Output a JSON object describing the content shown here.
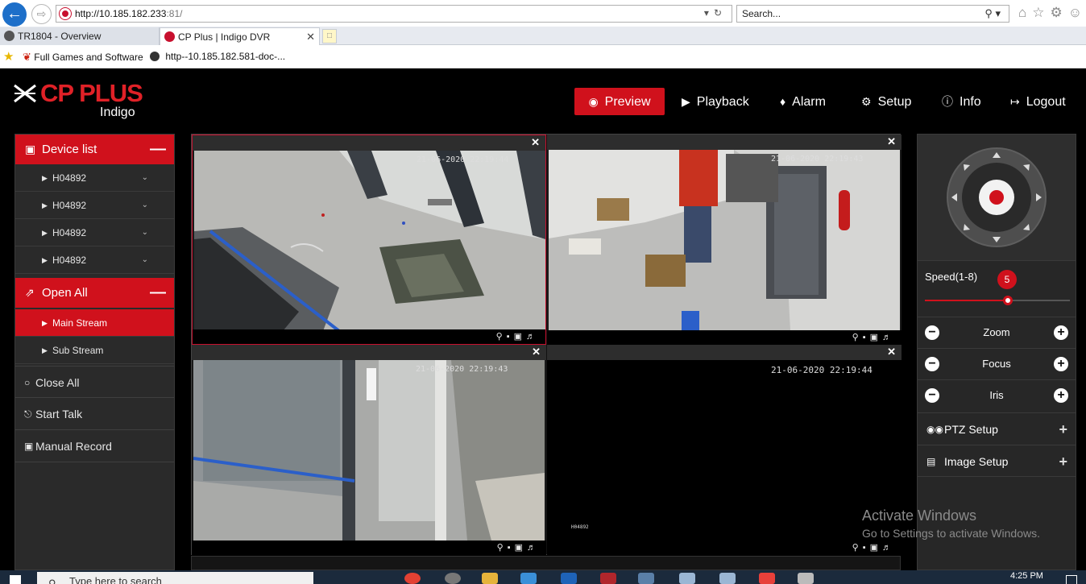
{
  "browser": {
    "url_host": "http://10.185.182.233",
    "url_port": ":81/",
    "search_placeholder": "Search...",
    "tabs": [
      {
        "label": "TR1804 - Overview"
      },
      {
        "label": "CP Plus | Indigo DVR"
      }
    ],
    "favorites": [
      {
        "label": "Full Games and Software"
      },
      {
        "label": "http--10.185.182.581-doc-..."
      }
    ]
  },
  "app": {
    "brand": "CP PLUS",
    "brand_sub": "Indigo",
    "brand_color": "#e02127",
    "accent_color": "#d0111c",
    "nav": [
      {
        "label": "Preview",
        "icon": "eye-icon",
        "active": true
      },
      {
        "label": "Playback",
        "icon": "play-icon"
      },
      {
        "label": "Alarm",
        "icon": "bell-icon"
      },
      {
        "label": "Setup",
        "icon": "gear-icon"
      },
      {
        "label": "Info",
        "icon": "info-icon"
      },
      {
        "label": "Logout",
        "icon": "logout-icon"
      }
    ]
  },
  "left_panel": {
    "device_list_label": "Device list",
    "devices": [
      {
        "label": "H04892"
      },
      {
        "label": "H04892"
      },
      {
        "label": "H04892"
      },
      {
        "label": "H04892"
      }
    ],
    "open_all_label": "Open All",
    "streams": [
      {
        "label": "Main Stream",
        "active": true
      },
      {
        "label": "Sub Stream"
      }
    ],
    "actions": [
      {
        "label": "Close All",
        "icon": "circle-icon"
      },
      {
        "label": "Start Talk",
        "icon": "microphone-icon"
      },
      {
        "label": "Manual Record",
        "icon": "video-camera-icon"
      }
    ]
  },
  "video_grid": {
    "cells": [
      {
        "timestamp": "21-06-2020 22:19:44",
        "selected": true
      },
      {
        "timestamp": "21-06-2020 22:19:43"
      },
      {
        "timestamp": "21-06-2020 22:19:43"
      },
      {
        "timestamp": "21-06-2020 22:19:44",
        "channel": "H04892"
      }
    ],
    "controls": [
      "zoom-icon",
      "record-icon",
      "snapshot-icon",
      "audio-icon"
    ]
  },
  "right_panel": {
    "speed_label": "Speed(1-8)",
    "speed_value": "5",
    "speed_min": 1,
    "speed_max": 8,
    "controls": [
      {
        "label": "Zoom"
      },
      {
        "label": "Focus"
      },
      {
        "label": "Iris"
      }
    ],
    "sections": [
      {
        "label": "PTZ Setup",
        "icon": "gamepad-icon"
      },
      {
        "label": "Image Setup",
        "icon": "image-icon"
      }
    ]
  },
  "watermark": {
    "title": "Activate Windows",
    "subtitle": "Go to Settings to activate Windows."
  },
  "taskbar": {
    "search_placeholder": "Type here to search",
    "time": "4:25 PM"
  }
}
